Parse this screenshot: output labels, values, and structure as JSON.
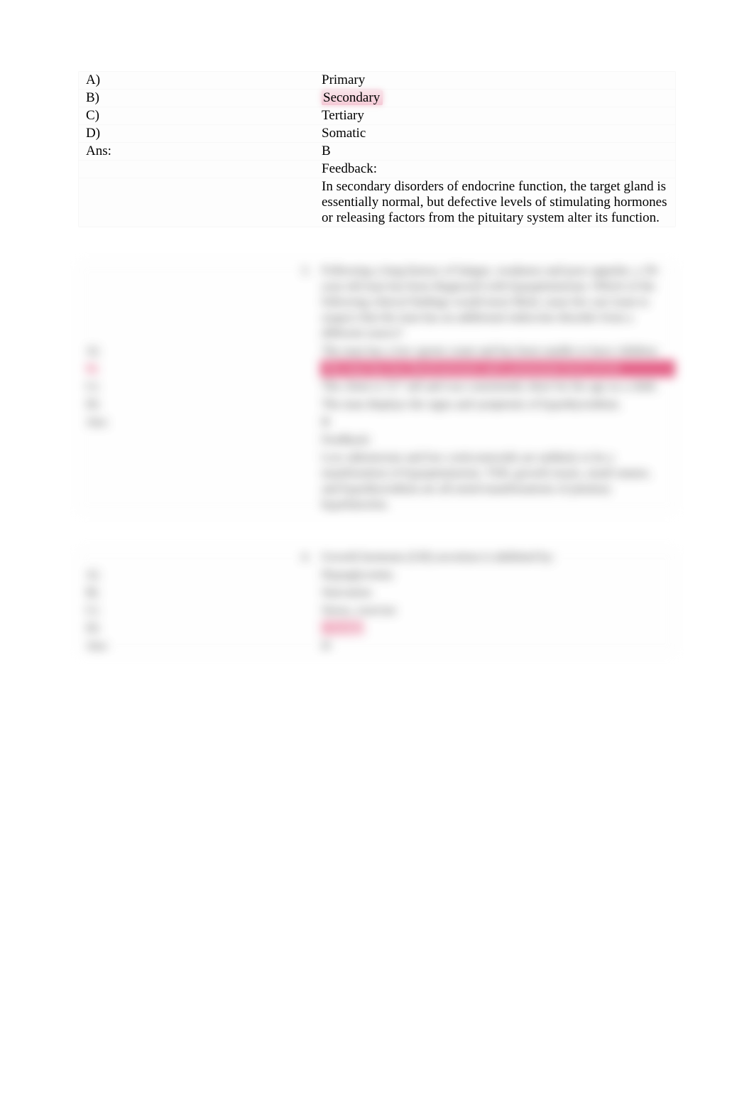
{
  "q1": {
    "options": [
      {
        "label": "A)",
        "text": "Primary"
      },
      {
        "label": "B)",
        "text": "Secondary",
        "highlight": true
      },
      {
        "label": "C)",
        "text": "Tertiary"
      },
      {
        "label": "D)",
        "text": "Somatic"
      }
    ],
    "ans_label": "Ans:",
    "ans_value": "B",
    "feedback_label": "Feedback:",
    "feedback_text": "In secondary disorders of endocrine function, the target gland is essentially normal, but defective levels of stimulating hormones or releasing factors from the pituitary system alter its function."
  },
  "q2": {
    "number": "3.",
    "stem": "Following a long history of fatigue, weakness and poor appetite, a 39-year-old man has been diagnosed with hypopituitarism. Which of the following clinical findings would most likely cause his care team to suspect that the man has an additional endocrine disorder from a different source?",
    "options": [
      {
        "label": "A)",
        "text": "The man has a low sperm count and has been unable to have children."
      },
      {
        "label": "B)",
        "text": "The man has low blood pressure and a potassium level of 6.8.",
        "highlight_row": true
      },
      {
        "label": "C)",
        "text": "The client is 5'2\" tall and was consistently short for his age as a child."
      },
      {
        "label": "D)",
        "text": "The man displays the signs and symptoms of hypothyroidism."
      }
    ],
    "ans_label": "Ans:",
    "ans_value": "B",
    "feedback_label": "Feedback:",
    "feedback_text": "Low aldosterone and low corticosteroids are unlikely to be a manifestation of hypopituitarism. TSH, growth issues, small stature, and hypothyroidism are all noted manifestations of pituitary hypofunction."
  },
  "q3": {
    "number": "4.",
    "stem": "Growth hormone (GH) secretion is inhibited by:",
    "options": [
      {
        "label": "A)",
        "text": "Hypoglycemia"
      },
      {
        "label": "B)",
        "text": "Starvation"
      },
      {
        "label": "C)",
        "text": "Stress, exercise"
      },
      {
        "label": "D)",
        "text": "Obesity",
        "pink": true
      }
    ],
    "ans_label": "Ans:",
    "ans_value": "D"
  }
}
